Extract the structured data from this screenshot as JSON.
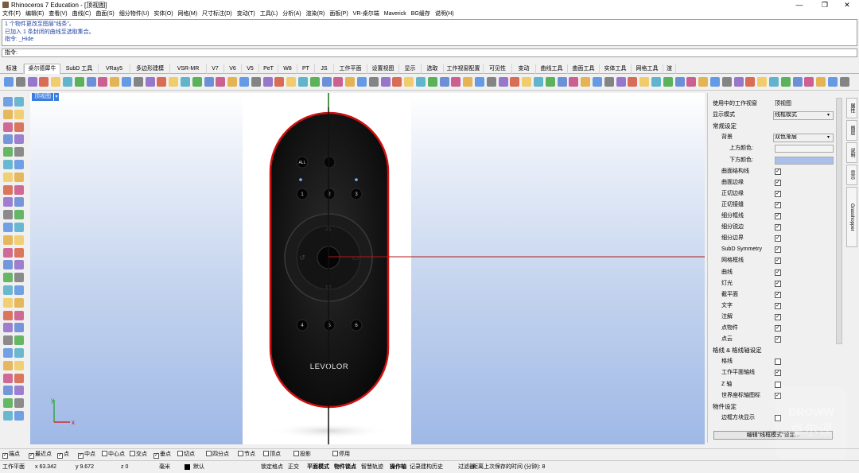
{
  "window": {
    "title": "Rhinoceros 7 Education - [顶视图]",
    "minimize_label": "—",
    "restore_label": "❐",
    "close_label": "✕"
  },
  "menu": [
    "文件(F)",
    "编辑(E)",
    "查看(V)",
    "曲线(C)",
    "曲面(S)",
    "细分物件(U)",
    "实体(O)",
    "网格(M)",
    "尺寸标注(D)",
    "变动(T)",
    "工具(L)",
    "分析(A)",
    "渲染(R)",
    "面板(P)",
    "VR-桌尔端",
    "Maverick",
    "BG缓存",
    "说明(H)"
  ],
  "command_history": [
    "1 个物件更改至图层\"线条\"。",
    "已加入 1 条封闭的曲线至选取集合。",
    "指令: _Hide"
  ],
  "command_prompt": "指令:",
  "tabs": [
    "标准",
    "桌尔德犀牛",
    "SubD 工具",
    "VRay5",
    "多边形建模",
    "VSR-MR",
    "V7",
    "V6",
    "V5",
    "PeT",
    "W8",
    "PT",
    "JS",
    "工作平面",
    "设置视图",
    "显示",
    "选取",
    "工作视窗配置",
    "可见性",
    "变动",
    "曲线工具",
    "曲面工具",
    "实体工具",
    "网格工具",
    "渲"
  ],
  "active_tab_index": 1,
  "viewport": {
    "label": "顶视图",
    "dropdown_icon": "▾",
    "product_brand": "LEVOLOR",
    "button_labels": [
      "ALL",
      "1",
      "2",
      "3",
      "4",
      "5",
      "6"
    ],
    "axis_x": "x",
    "axis_y": "y"
  },
  "panel": {
    "rows": [
      {
        "label": "使用中的工作视窗",
        "value": "顶视图",
        "kind": "field"
      },
      {
        "label": "显示模式",
        "value": "线框模式",
        "kind": "select"
      },
      {
        "label": "常规设定",
        "kind": "section"
      },
      {
        "label": "背景",
        "value": "双色渐层",
        "kind": "select-ind"
      },
      {
        "label": "上方颜色:",
        "kind": "color-top"
      },
      {
        "label": "下方颜色:",
        "kind": "color-bottom"
      },
      {
        "label": "曲面结构线",
        "kind": "check",
        "checked": true
      },
      {
        "label": "曲面边缘",
        "kind": "check",
        "checked": true
      },
      {
        "label": "正切边缘",
        "kind": "check",
        "checked": true
      },
      {
        "label": "正切接缝",
        "kind": "check",
        "checked": true
      },
      {
        "label": "细分框线",
        "kind": "check",
        "checked": true
      },
      {
        "label": "细分锐边",
        "kind": "check",
        "checked": true
      },
      {
        "label": "细分边界",
        "kind": "check",
        "checked": true
      },
      {
        "label": "SubD Symmetry",
        "kind": "check",
        "checked": true
      },
      {
        "label": "网格框线",
        "kind": "check",
        "checked": true
      },
      {
        "label": "曲线",
        "kind": "check",
        "checked": true
      },
      {
        "label": "灯光",
        "kind": "check",
        "checked": true
      },
      {
        "label": "截平面",
        "kind": "check",
        "checked": true
      },
      {
        "label": "文字",
        "kind": "check",
        "checked": true
      },
      {
        "label": "注解",
        "kind": "check",
        "checked": true
      },
      {
        "label": "点物件",
        "kind": "check",
        "checked": true
      },
      {
        "label": "点云",
        "kind": "check",
        "checked": true
      },
      {
        "label": "格线 & 格线轴设定",
        "kind": "section"
      },
      {
        "label": "格线",
        "kind": "check",
        "checked": false
      },
      {
        "label": "工作平面轴线",
        "kind": "check",
        "checked": true
      },
      {
        "label": "Z 轴",
        "kind": "check",
        "checked": false
      },
      {
        "label": "世界座标轴图标",
        "kind": "check",
        "checked": true
      },
      {
        "label": "物件设定",
        "kind": "section"
      },
      {
        "label": "边框方块显示",
        "kind": "check",
        "checked": false
      }
    ],
    "edit_button": "编辑\"线框模式\"设定...",
    "side_tabs": [
      "属性",
      "图层",
      "说明",
      "显示",
      "Grasshopper"
    ]
  },
  "osnap": [
    {
      "label": "端点",
      "checked": true
    },
    {
      "label": "最近点",
      "checked": true
    },
    {
      "label": "点",
      "checked": true
    },
    {
      "label": "中点",
      "checked": true
    },
    {
      "label": "中心点",
      "checked": false
    },
    {
      "label": "交点",
      "checked": false
    },
    {
      "label": "垂点",
      "checked": true
    },
    {
      "label": "切点",
      "checked": false
    },
    {
      "label": "四分点",
      "checked": false
    },
    {
      "label": "节点",
      "checked": false
    },
    {
      "label": "顶点",
      "checked": false
    },
    {
      "label": "投影",
      "checked": false
    },
    {
      "label": "停用",
      "checked": false
    }
  ],
  "status": {
    "workplane": "工作平面",
    "x": "x 63.342",
    "y": "y 9.672",
    "z": "z 0",
    "unit": "毫米",
    "layer": "默认",
    "toggles": [
      "锁定格点",
      "正交",
      "平面模式",
      "物件锁点",
      "智慧轨迹",
      "操作轴",
      "记录建构历史",
      "过滤器"
    ],
    "bold_toggles": [
      "平面模式",
      "物件锁点",
      "操作轴"
    ],
    "save_info": "距离上次保存的时间 (分钟): 8"
  },
  "watermark": {
    "line1": "DROWW",
    "line2": "卓尔谟"
  },
  "colors": {
    "accent": "#3a7de0",
    "remote_body": "#111111",
    "outline_red": "#d01010",
    "bottom_color": "#a9c0ea"
  }
}
